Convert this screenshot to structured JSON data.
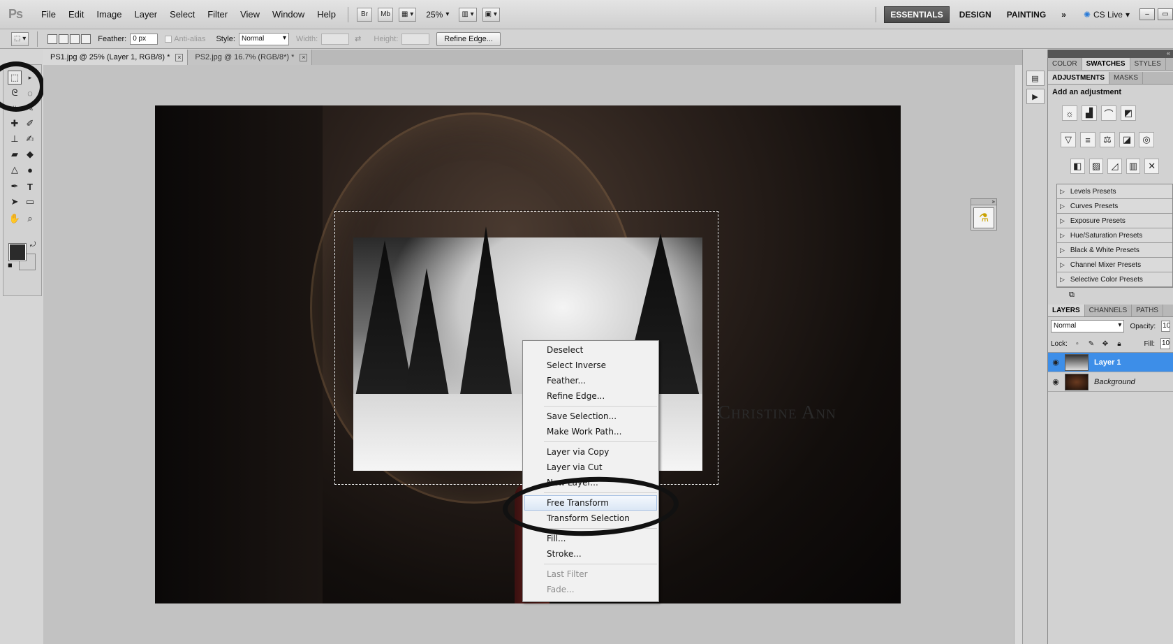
{
  "app": {
    "logo": "Ps",
    "menus": [
      "File",
      "Edit",
      "Image",
      "Layer",
      "Select",
      "Filter",
      "View",
      "Window",
      "Help"
    ],
    "bridge_label": "Br",
    "minibridge_label": "Mb",
    "zoom": "25%",
    "workspaces": [
      "ESSENTIALS",
      "DESIGN",
      "PAINTING"
    ],
    "active_workspace": "ESSENTIALS",
    "more": "»",
    "cs_live": "CS Live"
  },
  "options": {
    "feather_label": "Feather:",
    "feather_value": "0 px",
    "antialias_label": "Anti-alias",
    "style_label": "Style:",
    "style_value": "Normal",
    "width_label": "Width:",
    "height_label": "Height:",
    "refine_edge": "Refine Edge..."
  },
  "tabs": [
    {
      "label": "PS1.jpg @ 25% (Layer 1, RGB/8) *",
      "active": true
    },
    {
      "label": "PS2.jpg @ 16.7% (RGB/8*) *",
      "active": false
    }
  ],
  "canvas": {
    "watermark": "Christine Ann"
  },
  "context_menu": {
    "groups": [
      [
        "Deselect",
        "Select Inverse",
        "Feather...",
        "Refine Edge..."
      ],
      [
        "Save Selection...",
        "Make Work Path..."
      ],
      [
        "Layer via Copy",
        "Layer via Cut",
        "New Layer..."
      ],
      [
        "Free Transform",
        "Transform Selection"
      ],
      [
        "Fill...",
        "Stroke..."
      ],
      [
        "Last Filter",
        "Fade..."
      ]
    ],
    "hover": "Free Transform",
    "disabled": [
      "Last Filter",
      "Fade..."
    ]
  },
  "panels": {
    "top_tabs": [
      "COLOR",
      "SWATCHES",
      "STYLES"
    ],
    "top_active": "SWATCHES",
    "adj_tabs": [
      "ADJUSTMENTS",
      "MASKS"
    ],
    "adj_active": "ADJUSTMENTS",
    "adj_heading": "Add an adjustment",
    "presets": [
      "Levels Presets",
      "Curves Presets",
      "Exposure Presets",
      "Hue/Saturation Presets",
      "Black & White Presets",
      "Channel Mixer Presets",
      "Selective Color Presets"
    ],
    "layer_tabs": [
      "LAYERS",
      "CHANNELS",
      "PATHS"
    ],
    "layer_active": "LAYERS",
    "blend_mode": "Normal",
    "opacity_label": "Opacity:",
    "opacity_value": "10",
    "lock_label": "Lock:",
    "fill_label": "Fill:",
    "fill_value": "10",
    "layers": [
      {
        "name": "Layer 1",
        "selected": true
      },
      {
        "name": "Background",
        "selected": false
      }
    ]
  },
  "colors": {
    "selected_layer": "#3d8ee8",
    "menu_hover": "#dbe7f5"
  }
}
